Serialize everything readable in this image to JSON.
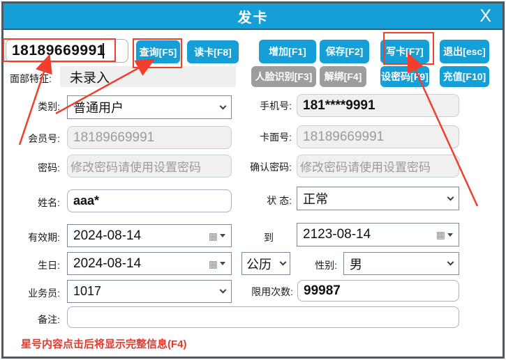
{
  "window": {
    "title": "发卡",
    "close": "X"
  },
  "colors": {
    "accent": "#159fd6",
    "gray_button": "#9d9d9d",
    "annotation": "#f23f2d",
    "note_text": "#e23b2e",
    "disabled_bg": "#f0f0f0"
  },
  "toolbar": {
    "card_no": "18189669991",
    "query": "查询[F5]",
    "read_card": "读卡[F8]",
    "add": "增加[F1]",
    "save": "保存[F2]",
    "write_card": "写卡[F7]",
    "exit": "退出[esc]",
    "face_label": "面部特征:",
    "face_value": "未录入",
    "face_recog": "人脸识别[F3]",
    "unbind": "解绑[F4]",
    "set_password": "设密码[F9]",
    "recharge": "充值[F10]"
  },
  "form": {
    "category": {
      "label": "类别:",
      "value": "普通用户"
    },
    "phone": {
      "label": "手机号:",
      "value": "181****9991"
    },
    "member_no": {
      "label": "会员号:",
      "value": "18189669991"
    },
    "card_face_no": {
      "label": "卡面号:",
      "value": "18189669991"
    },
    "password": {
      "label": "密码:",
      "value": "修改密码请使用设置密码"
    },
    "confirm_password": {
      "label": "确认密码:",
      "value": "修改密码请使用设置密码"
    },
    "name": {
      "label": "姓名:",
      "value": "aaa*"
    },
    "status": {
      "label": "状 态:",
      "value": "正常"
    },
    "valid_from": {
      "label": "有效期:",
      "value": "2024-08-14"
    },
    "valid_to": {
      "label": "到",
      "value": "2123-08-14"
    },
    "birthday": {
      "label": "生日:",
      "value": "2024-08-14"
    },
    "calendar_type": {
      "value": "公历"
    },
    "gender": {
      "label": "性别:",
      "value": "男"
    },
    "salesman": {
      "label": "业务员:",
      "value": "1017"
    },
    "usage_limit": {
      "label": "限用次数:",
      "value": "99987"
    },
    "remark": {
      "label": "备注:",
      "value": ""
    }
  },
  "note": "星号内容点击后将显示完整信息(F4)"
}
